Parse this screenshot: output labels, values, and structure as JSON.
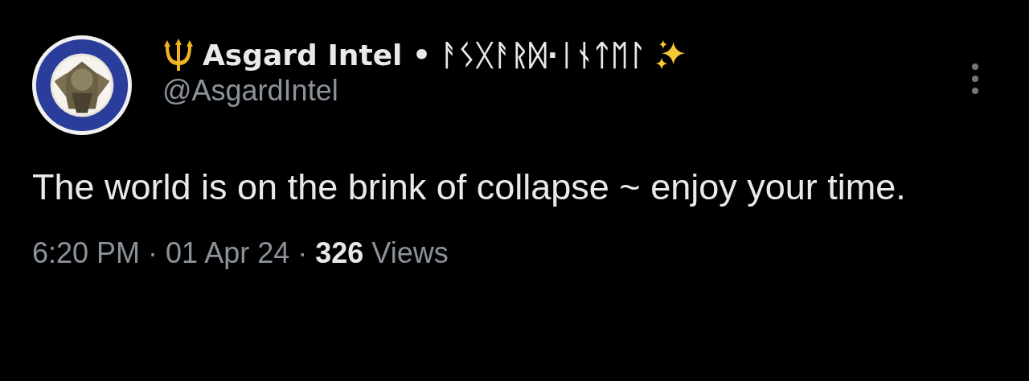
{
  "author": {
    "display_name": "Asgard Intel • ᚨᛊᚷᚨᚱᛞ·ᛁᚾᛏᛖᛚ",
    "handle": "@AsgardIntel"
  },
  "text": "The world is on the brink of collapse ~ enjoy your time.",
  "meta": {
    "time": "6:20 PM",
    "separator_1": "·",
    "date": "01 Apr 24",
    "separator_2": "·",
    "views_count": "326",
    "views_label": "Views"
  }
}
